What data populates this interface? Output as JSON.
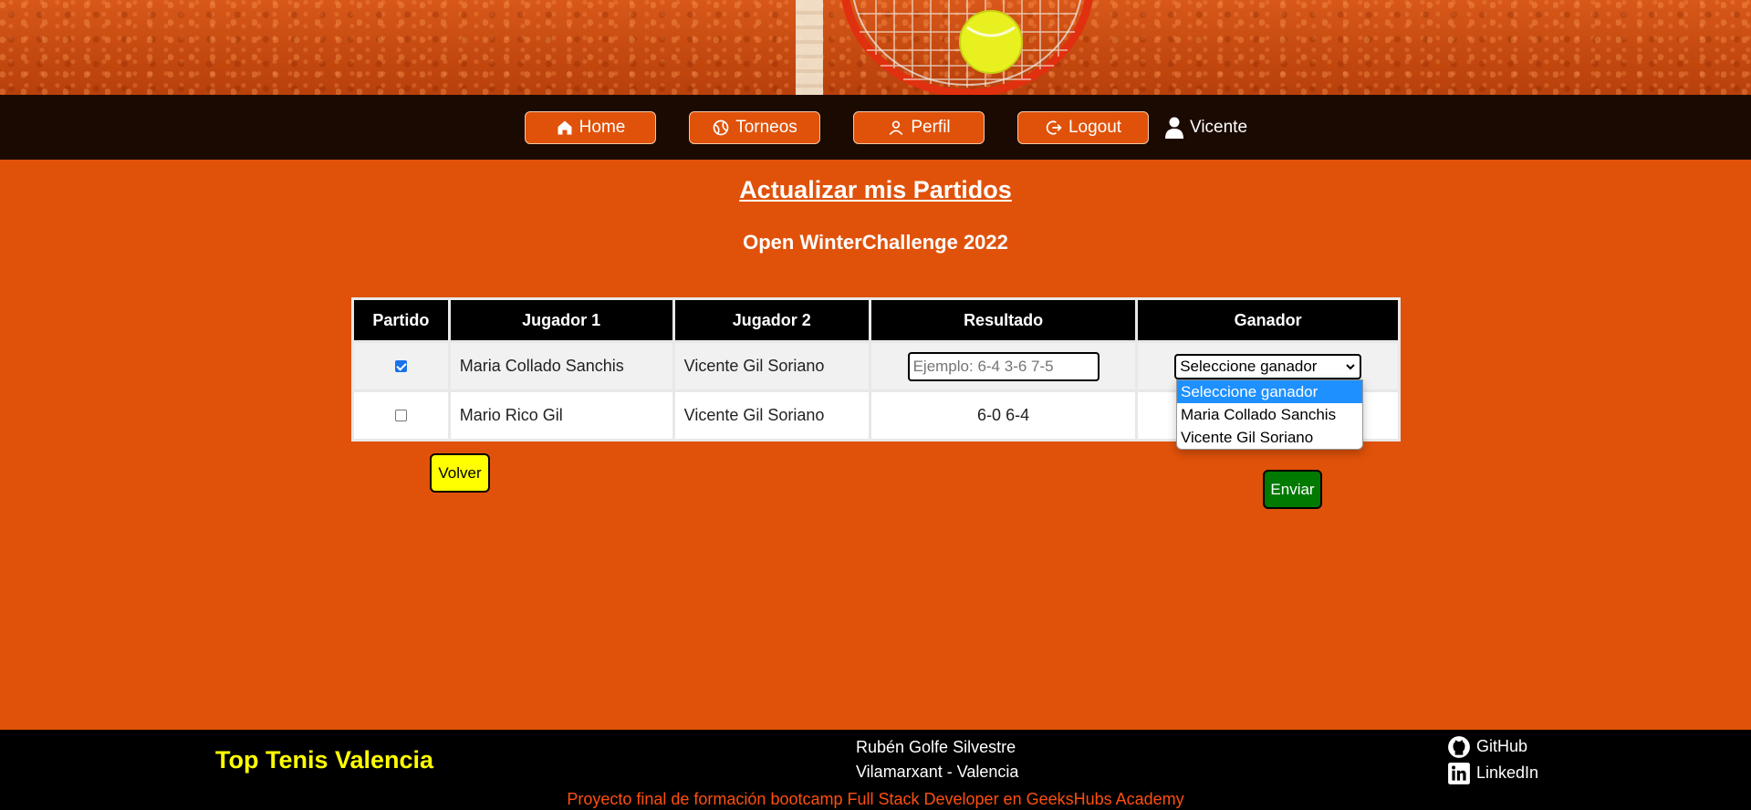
{
  "nav": {
    "home_label": "Home",
    "torneos_label": "Torneos",
    "perfil_label": "Perfil",
    "logout_label": "Logout",
    "user_name": "Vicente"
  },
  "main": {
    "title": "Actualizar mis Partidos",
    "tournament": "Open WinterChallenge 2022",
    "table": {
      "headers": [
        "Partido",
        "Jugador 1",
        "Jugador 2",
        "Resultado",
        "Ganador"
      ],
      "rows": [
        {
          "checked": true,
          "player1": "Maria Collado Sanchis",
          "player2": "Vicente Gil Soriano",
          "result_placeholder": "Ejemplo: 6-4 3-6 7-5",
          "winner": "Seleccione ganador"
        },
        {
          "checked": false,
          "player1": "Mario Rico Gil",
          "player2": "Vicente Gil Soriano",
          "result": "6-0 6-4"
        }
      ]
    },
    "winner_options": [
      "Seleccione ganador",
      "Maria Collado Sanchis",
      "Vicente Gil Soriano"
    ],
    "volver_label": "Volver",
    "enviar_label": "Enviar"
  },
  "footer": {
    "brand": "Top Tenis Valencia",
    "author_name": "Rubén Golfe Silvestre",
    "author_location": "Vilamarxant - Valencia",
    "github_label": "GitHub",
    "linkedin_label": "LinkedIn",
    "credit": "Proyecto final de formación bootcamp Full Stack Developer en GeeksHubs Academy"
  },
  "colors": {
    "accent": "#e0520a",
    "nav_bg": "#1b0a02",
    "brand": "#ffff00",
    "enviar": "#007a00"
  }
}
